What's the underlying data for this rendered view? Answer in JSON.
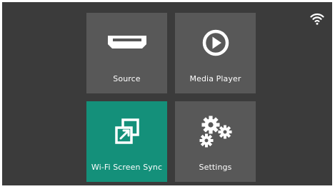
{
  "status_bar": {
    "wifi_icon": "wifi-signal-icon"
  },
  "menu": {
    "tiles": [
      {
        "label": "Source",
        "icon": "hdmi-port-icon",
        "selected": false
      },
      {
        "label": "Media Player",
        "icon": "play-circle-icon",
        "selected": false
      },
      {
        "label": "Wi-Fi Screen Sync",
        "icon": "screen-mirror-icon",
        "selected": true
      },
      {
        "label": "Settings",
        "icon": "gears-icon",
        "selected": false
      }
    ]
  },
  "colors": {
    "background": "#3b3b3b",
    "tile": "#585858",
    "tile_selected": "#14907a",
    "text": "#ffffff"
  }
}
